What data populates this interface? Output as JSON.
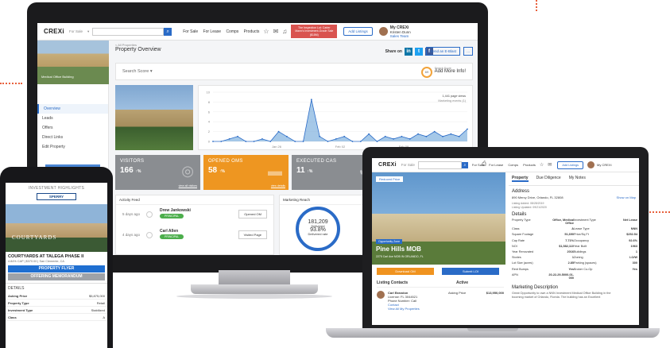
{
  "monitor": {
    "header": {
      "logo": "CREXi",
      "product_select": "For Sale",
      "search_placeholder": "",
      "nav": [
        "For Sale",
        "For Lease",
        "Comps",
        "Products"
      ],
      "promo": "The Inspection Lot: Carter Mann's Investment-Grade Sale ($18M)",
      "add_listings": "Add Listings",
      "user_name": "My CREXi",
      "user_sub": "Kristen Dunn",
      "user_link": "Sales Team"
    },
    "sidebar": {
      "caption": "Medical Office Building",
      "nav": [
        "Overview",
        "Leads",
        "Offers",
        "Direct Links",
        "Edit Property"
      ],
      "btn_update": "Update Status",
      "btn_download": "Download Lead Report"
    },
    "main": {
      "breadcrumb": "< All Properties",
      "title": "Property Overview",
      "share_label": "Share on",
      "send_eblast": "Send an E-Blast",
      "more": "...",
      "search_score": "Search Score",
      "score_value": "69",
      "score_small": "Search Score",
      "score_add": "Add More Info!"
    },
    "chart_data": {
      "type": "area",
      "x": [
        "Jan 26",
        "Feb 02",
        "Feb 09"
      ],
      "ylim": [
        0,
        10
      ],
      "yticks": [
        0,
        2,
        4,
        6,
        8,
        10
      ],
      "legend": [
        "1,441 page views",
        "Marketing events (1)"
      ],
      "series": [
        {
          "values": [
            0,
            0,
            0.5,
            1,
            0,
            0,
            0.5,
            0,
            2,
            1,
            0,
            0,
            8.5,
            1,
            0,
            0.5,
            1,
            0,
            0,
            1.5,
            0,
            1,
            0.5,
            1,
            0.5,
            1.5,
            1,
            2,
            1,
            1.5,
            1,
            2.5
          ]
        }
      ]
    },
    "stats": [
      {
        "label": "VISITORS",
        "value": "166",
        "delta": "↑%",
        "link": "view all visitors",
        "color": "#8a8d91"
      },
      {
        "label": "OPENED OMS",
        "value": "58",
        "delta": "↑%",
        "link": "view details",
        "color": "#ee9621"
      },
      {
        "label": "EXECUTED CAS",
        "value": "11",
        "delta": "↑%",
        "link": "",
        "color": "#8a8d91"
      }
    ],
    "activity": {
      "title": "Activity Feed",
      "rows": [
        {
          "ago": "5 days ago",
          "name": "Drew Jankowski",
          "tag": "PRINCIPAL",
          "action": "Opened OM"
        },
        {
          "ago": "4 days ago",
          "name": "Carl Allen",
          "tag": "PRINCIPAL",
          "action": "Visited Page"
        }
      ]
    },
    "reach": {
      "title": "Marketing Reach",
      "total": "181,209",
      "total_label": "Delivered",
      "pct": "93.8%",
      "pct_label": "Delivered rate"
    }
  },
  "laptop": {
    "header": {
      "logo": "CREXi",
      "select": "For Sale",
      "nav": [
        "For Sale",
        "For Lease",
        "Comps",
        "Products"
      ],
      "add_listings": "Add Listings",
      "user_name": "My CREXi"
    },
    "badge": "Reduced Price",
    "property_tag": "Opportunity Zone",
    "property_name": "Pine Hills MOB",
    "property_sub": "2275 Carl Ave MOB IN ORLANDO, FL",
    "btn_download": "Download OM",
    "btn_submit": "Submit LOI",
    "contacts_title": "Listing Contacts",
    "contact_name": "Carl Brandon",
    "contact_lines": [
      "License: FL 3044521",
      "Phone Number: Call",
      "Contact",
      "View All My Properties"
    ],
    "active_title": "Active",
    "asking_label": "Asking Price",
    "asking_value": "$13,950,000",
    "tabs": [
      "Property",
      "Due Diligence",
      "My Notes"
    ],
    "address_title": "Address",
    "address": "890 Mercy Drive, Orlando, FL 32808",
    "map_link": "Show on Map",
    "listed_on": "Listing Added: 08/28/2019",
    "updated_on": "Listing Updated: 09/21/2020",
    "details_title": "Details",
    "details": [
      [
        "Property Type",
        "Office, Medical Office",
        "Investment Type",
        "Net Lease"
      ],
      [
        "Class",
        "A",
        "Lease Type",
        "NNN"
      ],
      [
        "Square Footage",
        "51,690",
        "Price/Sq Ft",
        "$252.54"
      ],
      [
        "Cap Rate",
        "7.71%",
        "Occupancy",
        "92.6%"
      ],
      [
        "NOI",
        "$1,582,110",
        "Year Built",
        "1963"
      ],
      [
        "Year Renovated",
        "2016",
        "Buildings",
        "1"
      ],
      [
        "Stories",
        "1",
        "Zoning",
        "I-O/W"
      ],
      [
        "Lot Size (acres)",
        "2.85",
        "Parking (spaces)",
        "300"
      ],
      [
        "Rent Bumps",
        "Yes",
        "Broker Co-Op",
        "Yes"
      ],
      [
        "APN",
        "20-22-29-5000-01-000",
        "",
        ""
      ]
    ],
    "desc_title": "Marketing Description",
    "desc_text": "Great Opportunity to own a NNN Investment Medical Office Building in the booming market of Orlando, Florida. The building has an Excellent"
  },
  "phone": {
    "header": "INVESTMENT HIGHLIGHTS",
    "logo": "SPERRY",
    "image_text": "COURTYARDS",
    "title": "COURTYARDS AT TALEGA PHASE II",
    "subtitle": "4.84% CAP | $370.00 | San Clemente, CA",
    "btn1": "PROPERTY FLYER",
    "btn2": "OFFERING MEMORANDUM",
    "details_title": "DETAILS",
    "details": [
      [
        "Asking Price",
        "$5,875,000"
      ],
      [
        "Property Type",
        "Retail"
      ],
      [
        "Investment Type",
        "Stabilized"
      ],
      [
        "Class",
        "A"
      ]
    ]
  }
}
